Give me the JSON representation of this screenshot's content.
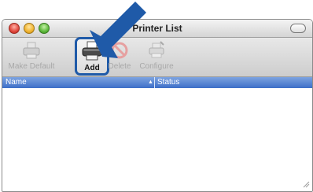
{
  "window": {
    "title": "Printer List"
  },
  "toolbar": {
    "make_default_label": "Make Default",
    "add_label": "Add",
    "delete_label": "Delete",
    "configure_label": "Configure"
  },
  "table": {
    "columns": [
      "Name",
      "Status"
    ],
    "rows": []
  },
  "colors": {
    "callout_blue": "#1f5aa8",
    "header_blue": "#3d6fc8"
  },
  "icons": [
    "printer-icon",
    "delete-icon",
    "configure-icon",
    "arrow-icon"
  ]
}
